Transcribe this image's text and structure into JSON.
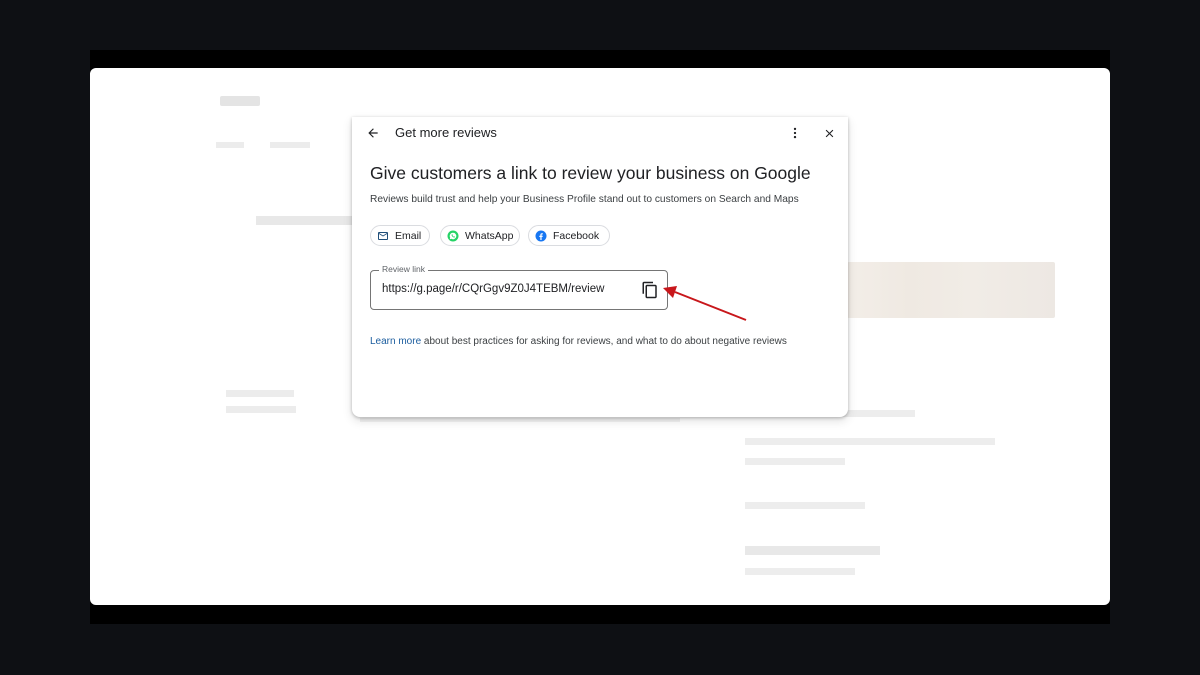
{
  "dialog": {
    "title": "Get more reviews",
    "heading": "Give customers a link to review your business on Google",
    "description": "Reviews build trust and help your Business Profile stand out to customers on Search and Maps",
    "share_options": [
      {
        "label": "Email",
        "icon": "mail-icon"
      },
      {
        "label": "WhatsApp",
        "icon": "whatsapp-icon"
      },
      {
        "label": "Facebook",
        "icon": "facebook-icon"
      }
    ],
    "review_link": {
      "label": "Review link",
      "value": "https://g.page/r/CQrGgv9Z0J4TEBM/review"
    },
    "footer": {
      "link_text": "Learn more",
      "text": " about best practices for asking for reviews, and what to do about negative reviews"
    }
  },
  "colors": {
    "link": "#1a5c9e",
    "whatsapp": "#25d366",
    "facebook": "#1877f2",
    "annotation_arrow": "#c8171b"
  }
}
